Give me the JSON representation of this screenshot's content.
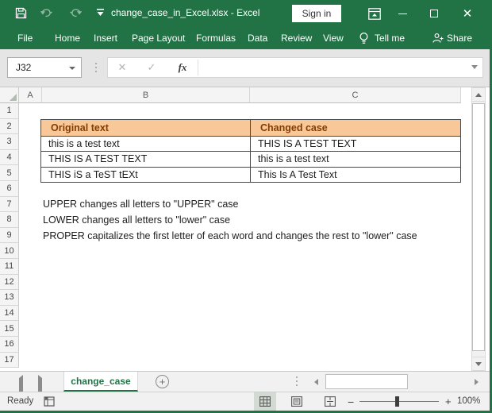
{
  "titlebar": {
    "title": "change_case_in_Excel.xlsx - Excel",
    "sign_in": "Sign in"
  },
  "ribbon": {
    "tabs": [
      "File",
      "Home",
      "Insert",
      "Page Layout",
      "Formulas",
      "Data",
      "Review",
      "View"
    ],
    "tell_me": "Tell me",
    "share": "Share"
  },
  "formula_bar": {
    "name_box": "J32",
    "fx_label": "fx",
    "value": ""
  },
  "grid": {
    "columns": [
      "A",
      "B",
      "C"
    ],
    "row_labels": [
      "1",
      "2",
      "3",
      "4",
      "5",
      "6",
      "7",
      "8",
      "9",
      "10",
      "11",
      "12",
      "13",
      "14",
      "15",
      "16",
      "17"
    ]
  },
  "table": {
    "header": [
      "Original text",
      "Changed case"
    ],
    "rows": [
      [
        "this is a test text",
        "THIS IS A TEST TEXT"
      ],
      [
        "THIS IS A TEST TEXT",
        "this is a test text"
      ],
      [
        "THIS iS a TeST tEXt",
        "This Is A Test Text"
      ]
    ],
    "header_fill": "#F9C898",
    "header_text_color": "#833C00"
  },
  "notes": {
    "line1": "UPPER changes all letters to \"UPPER\" case",
    "line2": "LOWER changes all letters to \"lower\" case",
    "line3": "PROPER capitalizes the first letter of each word and changes the rest to  \"lower\" case"
  },
  "sheet_tabs": {
    "active": "change_case",
    "add_label": "+"
  },
  "status_bar": {
    "ready": "Ready",
    "zoom": "100%"
  },
  "colors": {
    "excel_green": "#217346"
  }
}
